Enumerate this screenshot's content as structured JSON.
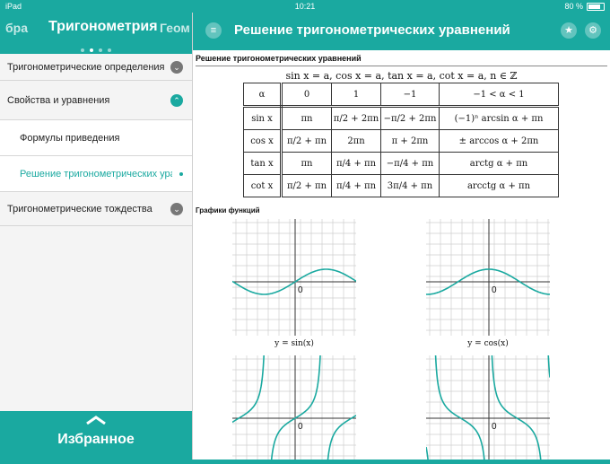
{
  "status": {
    "device": "iPad",
    "time": "10:21",
    "battery": "80 %"
  },
  "sidebar": {
    "prev": "бра",
    "current": "Тригонометрия",
    "next": "Геом",
    "items": [
      {
        "label": "Тригонометрические определения"
      },
      {
        "label": "Свойства и уравнения"
      },
      {
        "label": "Формулы приведения"
      },
      {
        "label": "Решение тригонометрических урав"
      },
      {
        "label": "Тригонометрические тождества"
      }
    ],
    "favorites": "Избранное"
  },
  "header": {
    "title": "Решение тригонометрических уравнений"
  },
  "content": {
    "heading": "Решение тригонометрических уравнений",
    "formula": "sin x = a, cos x = a, tan x = a, cot x = a, n ∈ ℤ",
    "table": {
      "header": [
        "α",
        "0",
        "1",
        "−1",
        "−1 < α < 1"
      ],
      "rows": [
        [
          "sin x",
          "πn",
          "π/2 + 2πn",
          "−π/2 + 2πn",
          "(−1)ⁿ arcsin α + πn"
        ],
        [
          "cos x",
          "π/2 + πn",
          "2πn",
          "π + 2πn",
          "± arccos α + 2πn"
        ],
        [
          "tan x",
          "πn",
          "π/4 + πn",
          "−π/4 + πn",
          "arctg α + πn"
        ],
        [
          "cot x",
          "π/2 + πn",
          "π/4 + πn",
          "3π/4 + πn",
          "arcctg α + πn"
        ]
      ]
    },
    "graphs_title": "Графики функций",
    "graphs": [
      {
        "caption": "y = sin(x)",
        "origin": "0"
      },
      {
        "caption": "y = cos(x)",
        "origin": "0"
      },
      {
        "caption": "",
        "origin": "0"
      },
      {
        "caption": "",
        "origin": "0"
      }
    ]
  },
  "colors": {
    "accent": "#1aa9a0",
    "curve": "#1aa9a0"
  }
}
